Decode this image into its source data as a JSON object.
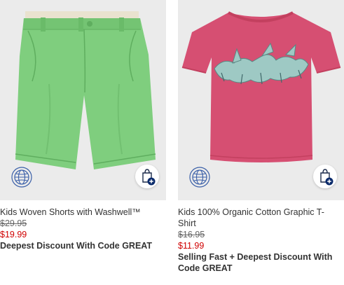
{
  "products": [
    {
      "name": "Kids Woven Shorts with Washwell™",
      "original_price": "$29.95",
      "sale_price": "$19.99",
      "promo": "Deepest Discount With Code GREAT",
      "icons": {
        "badge": "globe-icon",
        "action": "shopping-bag-plus-icon"
      },
      "colors": {
        "product": "#7fce7e",
        "sale_price": "#d00000"
      }
    },
    {
      "name": "Kids 100% Organic Cotton Graphic T-Shirt",
      "original_price": "$16.95",
      "sale_price": "$11.99",
      "promo": "Selling Fast + Deepest Discount With Code GREAT",
      "icons": {
        "badge": "globe-icon",
        "action": "shopping-bag-plus-icon"
      },
      "colors": {
        "product": "#d64f72",
        "sale_price": "#d00000"
      }
    }
  ]
}
